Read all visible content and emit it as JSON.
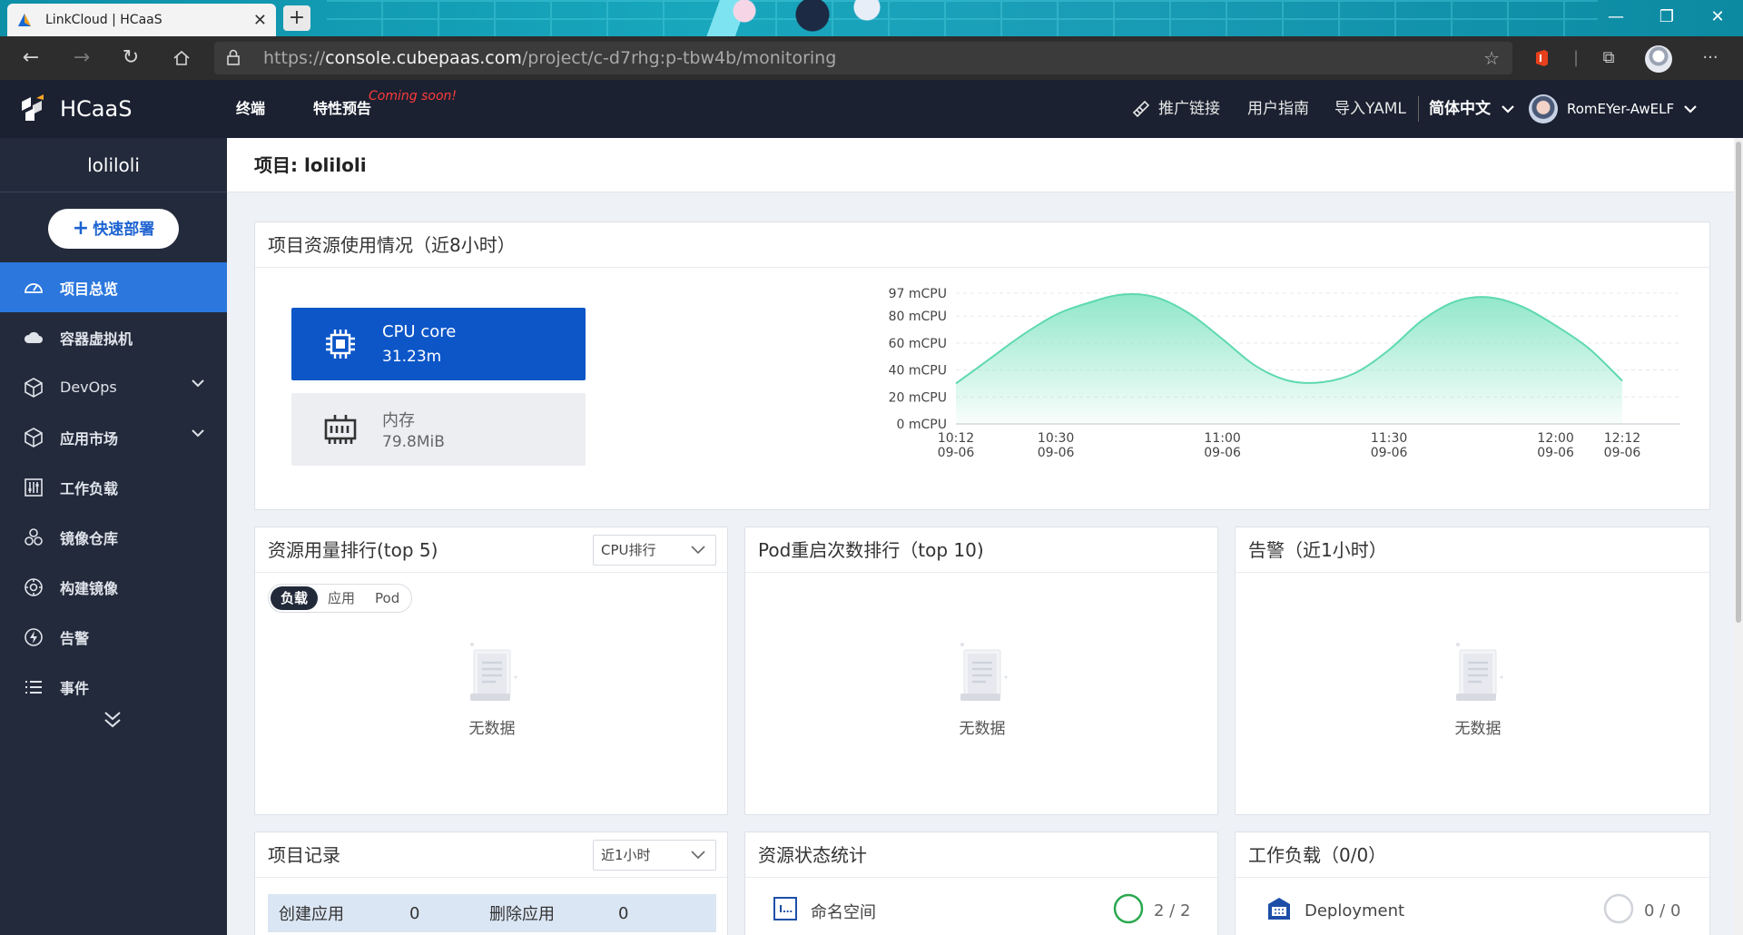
{
  "browser": {
    "tab_title": "LinkCloud | HCaaS",
    "url_scheme": "https://",
    "url_host": "console.cubepaas.com",
    "url_path": "/project/c-d7rhg:p-tbw4b/monitoring"
  },
  "header": {
    "brand": "HCaaS",
    "nav": [
      "终端",
      "特性预告"
    ],
    "coming_soon": "Coming soon!",
    "promo_link": "推广链接",
    "user_guide": "用户指南",
    "import_yaml": "导入YAML",
    "language": "简体中文",
    "username": "RomEYer-AwELF"
  },
  "sidebar": {
    "project": "loliloli",
    "deploy_button": "快速部署",
    "items": [
      {
        "label": "项目总览",
        "icon": "dashboard-icon",
        "active": true
      },
      {
        "label": "容器虚拟机",
        "icon": "cloud-icon"
      },
      {
        "label": "DevOps",
        "icon": "cube-icon",
        "expandable": true
      },
      {
        "label": "应用市场",
        "icon": "box-icon",
        "expandable": true
      },
      {
        "label": "工作负载",
        "icon": "sliders-icon"
      },
      {
        "label": "镜像仓库",
        "icon": "layers-icon"
      },
      {
        "label": "构建镜像",
        "icon": "gear-icon"
      },
      {
        "label": "告警",
        "icon": "bolt-icon"
      },
      {
        "label": "事件",
        "icon": "list-icon"
      }
    ]
  },
  "page": {
    "title": "项目: loliloli"
  },
  "usage": {
    "title": "项目资源使用情况（近8小时）",
    "cpu_label": "CPU core",
    "cpu_value": "31.23m",
    "mem_label": "内存",
    "mem_value": "79.8MiB"
  },
  "chart_data": {
    "type": "area",
    "y_unit": "mCPU",
    "y_ticks": [
      "97 mCPU",
      "80 mCPU",
      "60 mCPU",
      "40 mCPU",
      "20 mCPU",
      "0 mCPU"
    ],
    "ylim": [
      0,
      97
    ],
    "x_ticks": [
      {
        "time": "10:12",
        "date": "09-06"
      },
      {
        "time": "10:30",
        "date": "09-06"
      },
      {
        "time": "11:00",
        "date": "09-06"
      },
      {
        "time": "11:30",
        "date": "09-06"
      },
      {
        "time": "12:00",
        "date": "09-06"
      },
      {
        "time": "12:12",
        "date": "09-06"
      }
    ],
    "x_minutes": [
      612,
      630,
      660,
      690,
      720,
      732
    ],
    "series": [
      {
        "points": [
          {
            "x": "10:12",
            "y": 30
          },
          {
            "x": "10:18",
            "y": 48
          },
          {
            "x": "10:24",
            "y": 66
          },
          {
            "x": "10:30",
            "y": 81
          },
          {
            "x": "10:36",
            "y": 90
          },
          {
            "x": "10:42",
            "y": 96
          },
          {
            "x": "10:48",
            "y": 94
          },
          {
            "x": "10:54",
            "y": 82
          },
          {
            "x": "11:00",
            "y": 63
          },
          {
            "x": "11:06",
            "y": 43
          },
          {
            "x": "11:12",
            "y": 32
          },
          {
            "x": "11:18",
            "y": 31
          },
          {
            "x": "11:24",
            "y": 38
          },
          {
            "x": "11:30",
            "y": 55
          },
          {
            "x": "11:36",
            "y": 77
          },
          {
            "x": "11:42",
            "y": 91
          },
          {
            "x": "11:48",
            "y": 94
          },
          {
            "x": "11:54",
            "y": 87
          },
          {
            "x": "12:00",
            "y": 73
          },
          {
            "x": "12:06",
            "y": 56
          },
          {
            "x": "12:12",
            "y": 32
          }
        ]
      }
    ],
    "colors": {
      "line": "#5ed9b0",
      "fill": "#8ae6c6"
    }
  },
  "ranking": {
    "title": "资源用量排行(top 5)",
    "select": "CPU排行",
    "tabs": [
      "负载",
      "应用",
      "Pod"
    ],
    "empty": "无数据"
  },
  "pod_restart": {
    "title": "Pod重启次数排行（top 10)",
    "empty": "无数据"
  },
  "alerts": {
    "title": "告警（近1小时）",
    "empty": "无数据"
  },
  "records": {
    "title": "项目记录",
    "select": "近1小时",
    "create_label": "创建应用",
    "create_value": "0",
    "delete_label": "删除应用",
    "delete_value": "0"
  },
  "resource_status": {
    "title": "资源状态统计",
    "namespace_label": "命名空间",
    "namespace_value": "2 / 2"
  },
  "workload": {
    "title": "工作负载（0/0）",
    "deployment_label": "Deployment",
    "deployment_value": "0 / 0"
  },
  "colors": {
    "primary": "#0d56c8",
    "sidebar_bg": "#232a3b",
    "header_bg": "#1b2131",
    "active_item": "#2b77dd",
    "status_green": "#2aa84f"
  }
}
